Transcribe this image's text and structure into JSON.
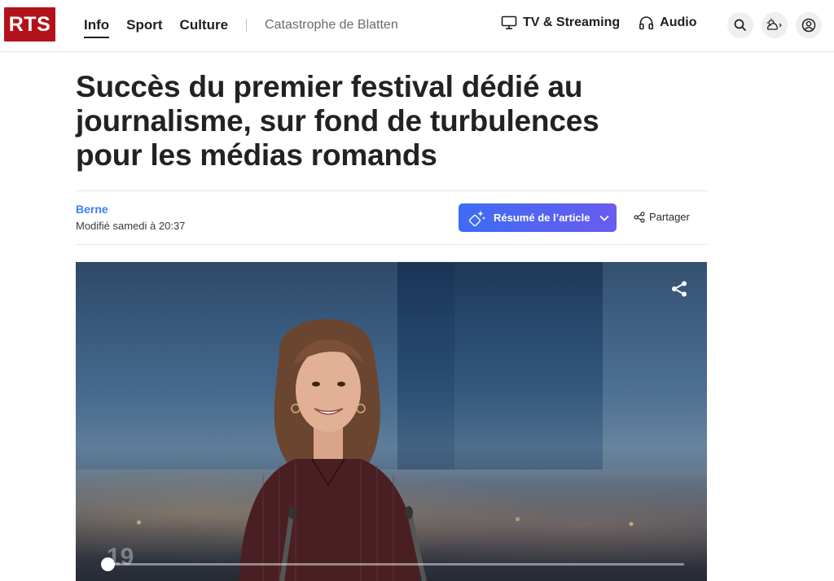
{
  "header": {
    "logo_text": "RTS",
    "nav": [
      {
        "label": "Info",
        "active": true
      },
      {
        "label": "Sport",
        "active": false
      },
      {
        "label": "Culture",
        "active": false
      }
    ],
    "topic": "Catastrophe de Blatten",
    "media_links": [
      {
        "label": "TV & Streaming",
        "icon": "tv-icon"
      },
      {
        "label": "Audio",
        "icon": "headphones-icon"
      }
    ],
    "icons": [
      "search-icon",
      "weather-icon",
      "account-icon"
    ]
  },
  "article": {
    "headline": "Succès du premier festival dédié au journalisme, sur fond de turbulences pour les médias romands",
    "location": "Berne",
    "modified": "Modifié samedi à 20:37",
    "summary_button": "Résumé de l’article",
    "share_label": "Partager"
  },
  "video": {
    "watermark": "19",
    "progress": 0.0
  },
  "colors": {
    "brand_red": "#b2131a",
    "link_blue": "#3b82f6",
    "summary_gradient_start": "#3d6cf2",
    "summary_gradient_end": "#6a5bf0"
  }
}
